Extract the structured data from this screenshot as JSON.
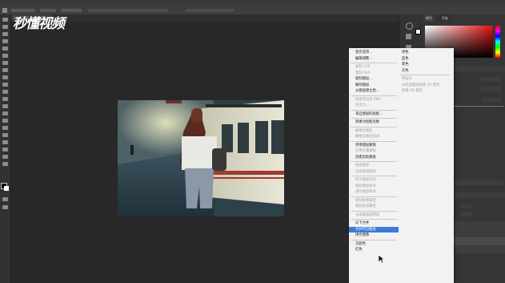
{
  "watermark": "秒懂视频",
  "document_tab": {
    "label": "00 ● 图层 4, RGB/8# ×",
    "close_icon": "×"
  },
  "context_menu": {
    "left_items": [
      {
        "label": "混合选项...",
        "disabled": false
      },
      {
        "label": "编辑调整...",
        "disabled": false
      },
      {
        "sep": true
      },
      {
        "label": "复制 CSS",
        "disabled": true
      },
      {
        "label": "复制 SVG",
        "disabled": true
      },
      {
        "label": "复制图层...",
        "disabled": false
      },
      {
        "label": "删除图层",
        "disabled": false
      },
      {
        "label": "从图层建立组...",
        "disabled": false
      },
      {
        "sep": true
      },
      {
        "label": "快速导出为 PNG",
        "disabled": true
      },
      {
        "label": "导出为...",
        "disabled": true
      },
      {
        "sep": true
      },
      {
        "label": "来自图层的画板...",
        "disabled": false
      },
      {
        "sep": true
      },
      {
        "label": "转换为智能对象",
        "disabled": false
      },
      {
        "sep": true
      },
      {
        "label": "栅格化图层",
        "disabled": true
      },
      {
        "label": "栅格化图层样式",
        "disabled": true
      },
      {
        "sep": true
      },
      {
        "label": "停用图层蒙版",
        "disabled": false
      },
      {
        "label": "启用矢量蒙版",
        "disabled": true
      },
      {
        "label": "创建剪贴蒙版",
        "disabled": false
      },
      {
        "sep": true
      },
      {
        "label": "链接图层",
        "disabled": true
      },
      {
        "label": "选择链接图层",
        "disabled": true
      },
      {
        "sep": true
      },
      {
        "label": "拷贝图层样式",
        "disabled": true
      },
      {
        "label": "粘贴图层样式",
        "disabled": true
      },
      {
        "label": "清除图层样式",
        "disabled": true
      },
      {
        "sep": true
      },
      {
        "label": "复制形状属性",
        "disabled": true
      },
      {
        "label": "粘贴形状属性",
        "disabled": true
      },
      {
        "sep": true
      },
      {
        "label": "从隔离图层释放",
        "disabled": true
      },
      {
        "sep": true
      },
      {
        "label": "向下合并",
        "disabled": false
      },
      {
        "label": "合并可见图层",
        "disabled": false,
        "highlighted": true
      },
      {
        "label": "拼合图像",
        "disabled": false
      },
      {
        "sep": true
      },
      {
        "label": "无颜色",
        "disabled": false
      },
      {
        "label": "红色",
        "disabled": false
      }
    ],
    "right_items": [
      {
        "label": "绿色",
        "disabled": false
      },
      {
        "label": "蓝色",
        "disabled": false
      },
      {
        "label": "紫色",
        "disabled": false
      },
      {
        "label": "灰色",
        "disabled": false
      },
      {
        "sep": true
      },
      {
        "label": "明信片",
        "disabled": true
      },
      {
        "label": "从所选图层新建 3D 模型",
        "disabled": true
      },
      {
        "label": "新建 3D 模型",
        "disabled": true
      }
    ]
  },
  "panels": {
    "tab_color": "颜色",
    "tab_swatches": "色板"
  },
  "colors": {
    "highlight": "#3b7cd6",
    "app_bg": "#282828"
  }
}
